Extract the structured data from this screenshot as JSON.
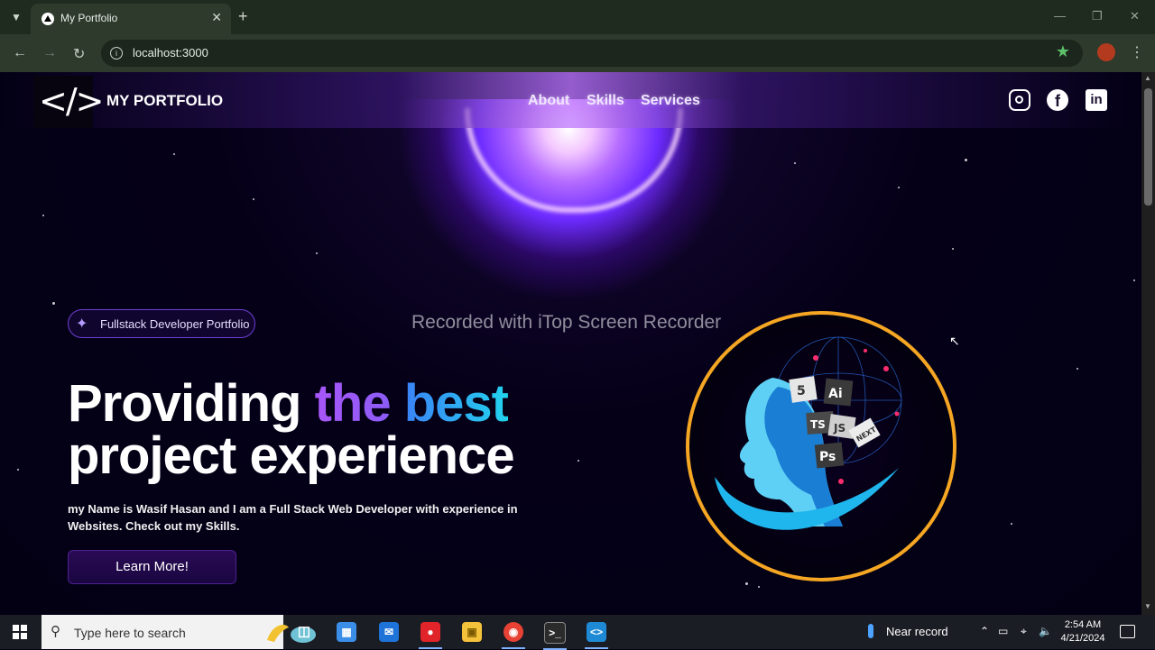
{
  "browser": {
    "tab_title": "My Portfolio",
    "url": "localhost:3000"
  },
  "page": {
    "brand": "MY PORTFOLIO",
    "nav": [
      {
        "label": "About"
      },
      {
        "label": "Skills"
      },
      {
        "label": "Services"
      }
    ],
    "social_icons": [
      "instagram-icon",
      "facebook-icon",
      "linkedin-icon"
    ],
    "badge": "Fullstack Developer Portfolio",
    "watermark": "Recorded with iTop Screen Recorder",
    "headline": {
      "part1": "Providing ",
      "part2": "the",
      "part3": "best",
      "line2": "project experience"
    },
    "description": "my Name is Wasif Hasan and I am a Full Stack Web Developer with experience in Websites. Check out my Skills.",
    "cta": "Learn More!",
    "hero_tiles": [
      "5",
      "Ai",
      "TS",
      "JS",
      "NEXT",
      "Ps"
    ]
  },
  "taskbar": {
    "search_placeholder": "Type here to search",
    "weather": "Near record",
    "time": "2:54 AM",
    "date": "4/21/2024"
  },
  "colors": {
    "page_bg": "#030014",
    "accent_purple": "#a855f7",
    "accent_blue": "#3b82f6",
    "ring_orange": "#f5a623"
  }
}
